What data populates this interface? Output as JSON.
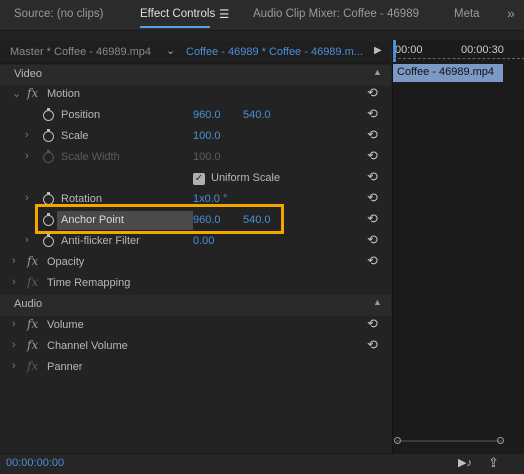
{
  "tabs": [
    {
      "label": "Source: (no clips)"
    },
    {
      "label": "Effect Controls"
    },
    {
      "label": "☰"
    },
    {
      "label": "Audio Clip Mixer: Coffee - 46989"
    },
    {
      "label": "Meta"
    },
    {
      "label": "»"
    }
  ],
  "clip_header": {
    "master": "Master * Coffee - 46989.mp4",
    "chevron": "⌄",
    "sequence": "Coffee - 46989 * Coffee - 46989.m...",
    "play": "▶"
  },
  "timeline": {
    "start_tc": "00:00",
    "end_tc": "00:00:30",
    "clip_name": "Coffee - 46989.mp4"
  },
  "sections": {
    "video": "Video",
    "audio": "Audio"
  },
  "rows": {
    "motion": "Motion",
    "position": {
      "label": "Position",
      "x": "960.0",
      "y": "540.0"
    },
    "scale": {
      "label": "Scale",
      "value": "100.0"
    },
    "scale_width": {
      "label": "Scale Width",
      "value": "100.0"
    },
    "uniform_scale": "Uniform Scale",
    "rotation": {
      "label": "Rotation",
      "value": "1x0.0 °"
    },
    "anchor_point": {
      "label": "Anchor Point",
      "x": "960.0",
      "y": "540.0"
    },
    "anti_flicker": {
      "label": "Anti-flicker Filter",
      "value": "0.00"
    },
    "opacity": "Opacity",
    "time_remapping": "Time Remapping",
    "volume": "Volume",
    "channel_volume": "Channel Volume",
    "panner": "Panner"
  },
  "fx_glyph": "fx",
  "reset_glyph": "⟲",
  "bottom": {
    "timecode": "00:00:00:00",
    "play_glyph": "▶♪",
    "export_glyph": "⇪"
  },
  "colors": {
    "accent": "#4a90d9",
    "highlight": "#f0a800",
    "clip": "#7b99c4"
  }
}
